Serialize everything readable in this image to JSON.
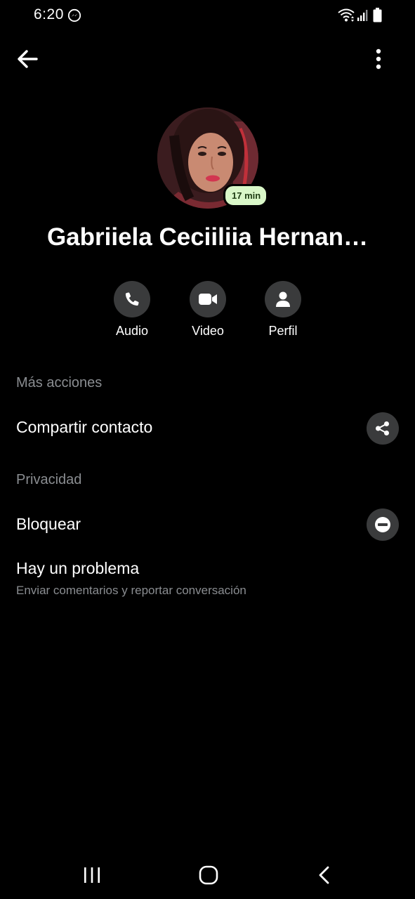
{
  "status_bar": {
    "time": "6:20"
  },
  "contact": {
    "name": "Gabriiela Ceciiliia Hernan…",
    "active_badge": "17 min"
  },
  "actions": [
    {
      "label": "Audio",
      "icon": "phone-icon"
    },
    {
      "label": "Video",
      "icon": "video-camera-icon"
    },
    {
      "label": "Perfil",
      "icon": "person-icon"
    }
  ],
  "sections": {
    "more_actions": {
      "header": "Más acciones",
      "share_contact": {
        "label": "Compartir contacto",
        "icon": "share-icon"
      }
    },
    "privacy": {
      "header": "Privacidad",
      "block": {
        "label": "Bloquear",
        "icon": "block-icon"
      },
      "problem": {
        "label": "Hay un problema",
        "subtitle": "Enviar comentarios y reportar conversación"
      }
    }
  },
  "colors": {
    "background": "#000000",
    "text_primary": "#ffffff",
    "text_secondary": "#8a8d91",
    "button_bg": "#3a3b3c",
    "active_badge_bg": "#d9f7c8"
  }
}
